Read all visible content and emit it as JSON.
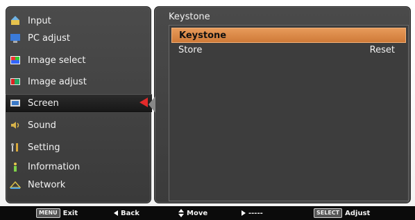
{
  "menu": {
    "items": [
      {
        "label": "Input",
        "icon": "input-icon"
      },
      {
        "label": "PC adjust",
        "icon": "pc-adjust-icon"
      },
      {
        "label": "Image select",
        "icon": "image-select-icon"
      },
      {
        "label": "Image adjust",
        "icon": "image-adjust-icon"
      },
      {
        "label": "Screen",
        "icon": "screen-icon",
        "selected": true
      },
      {
        "label": "Sound",
        "icon": "sound-icon"
      },
      {
        "label": "Setting",
        "icon": "setting-icon"
      },
      {
        "label": "Information",
        "icon": "information-icon"
      },
      {
        "label": "Network",
        "icon": "network-icon"
      }
    ]
  },
  "content": {
    "title": "Keystone",
    "rows": [
      {
        "label": "Keystone",
        "value": ""
      },
      {
        "label": "Store",
        "value": "Reset"
      }
    ]
  },
  "footer": {
    "menu_key": "MENU",
    "exit": "Exit",
    "back": "Back",
    "move": "Move",
    "right": "-----",
    "select_key": "SELECT",
    "adjust": "Adjust"
  },
  "colors": {
    "highlight": "#dd8a48",
    "accent_arrow": "#e22a2a"
  }
}
